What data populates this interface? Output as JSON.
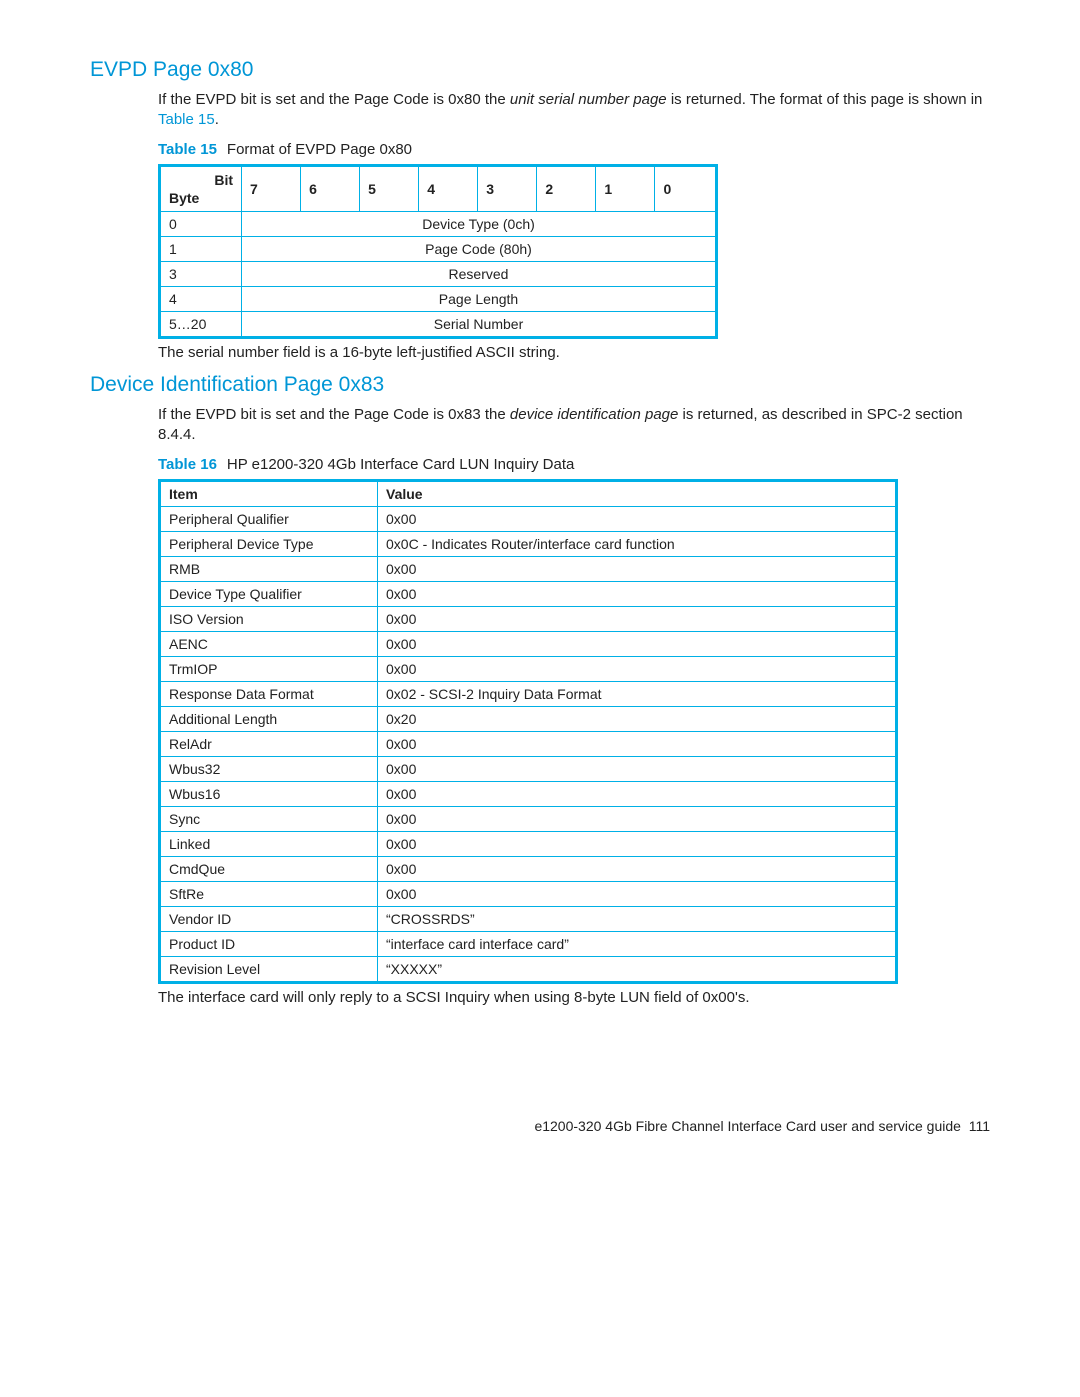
{
  "section1": {
    "heading": "EVPD Page 0x80",
    "para_pre": "If the EVPD bit is set and the Page Code is 0x80 the ",
    "para_ital": "unit serial number page",
    "para_post1": " is returned. The format of this page is shown in ",
    "para_link": "Table 15",
    "para_post2": ".",
    "table_label": "Table 15",
    "table_title": "Format of EVPD Page 0x80",
    "bit_label": "Bit",
    "byte_label": "Byte",
    "bits": [
      "7",
      "6",
      "5",
      "4",
      "3",
      "2",
      "1",
      "0"
    ],
    "rows": [
      {
        "byte": "0",
        "span": "Device Type (0ch)"
      },
      {
        "byte": "1",
        "span": "Page Code (80h)"
      },
      {
        "byte": "3",
        "span": "Reserved"
      },
      {
        "byte": "4",
        "span": "Page Length"
      },
      {
        "byte": "5…20",
        "span": "Serial Number"
      }
    ],
    "after": "The serial number field is a 16-byte left-justified ASCII string."
  },
  "section2": {
    "heading": "Device Identification Page 0x83",
    "para_pre": "If the EVPD bit is set and the Page Code is 0x83 the ",
    "para_ital": "device identification page",
    "para_post": " is returned, as described in SPC-2 section 8.4.4.",
    "table_label": "Table 16",
    "table_title": "HP e1200-320 4Gb Interface Card LUN Inquiry Data",
    "head_item": "Item",
    "head_value": "Value",
    "rows": [
      {
        "item": "Peripheral Qualifier",
        "value": "0x00"
      },
      {
        "item": "Peripheral Device Type",
        "value": "0x0C - Indicates Router/interface card function"
      },
      {
        "item": "RMB",
        "value": "0x00"
      },
      {
        "item": "Device Type Qualifier",
        "value": "0x00"
      },
      {
        "item": "ISO Version",
        "value": "0x00"
      },
      {
        "item": "AENC",
        "value": "0x00"
      },
      {
        "item": "TrmIOP",
        "value": "0x00"
      },
      {
        "item": "Response Data Format",
        "value": "0x02 - SCSI-2 Inquiry Data Format"
      },
      {
        "item": "Additional Length",
        "value": "0x20"
      },
      {
        "item": "RelAdr",
        "value": "0x00"
      },
      {
        "item": "Wbus32",
        "value": "0x00"
      },
      {
        "item": "Wbus16",
        "value": "0x00"
      },
      {
        "item": "Sync",
        "value": "0x00"
      },
      {
        "item": "Linked",
        "value": "0x00"
      },
      {
        "item": "CmdQue",
        "value": "0x00"
      },
      {
        "item": "SftRe",
        "value": "0x00"
      },
      {
        "item": "Vendor ID",
        "value": "“CROSSRDS”"
      },
      {
        "item": "Product ID",
        "value": "“interface card interface card”"
      },
      {
        "item": "Revision Level",
        "value": "“XXXXX”"
      }
    ],
    "after": "The interface card will only reply to a SCSI Inquiry when using 8-byte LUN field of 0x00's."
  },
  "footer": {
    "text": "e1200-320 4Gb Fibre Channel Interface Card user and service guide",
    "page": "111"
  }
}
